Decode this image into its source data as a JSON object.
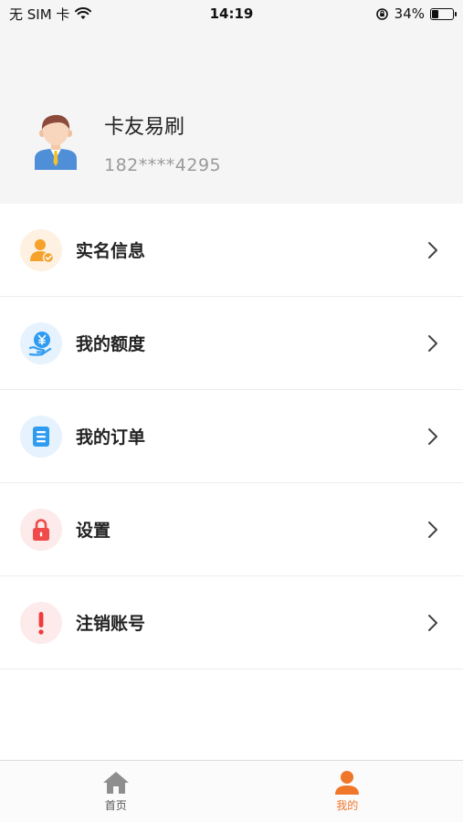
{
  "status_bar": {
    "carrier": "无 SIM 卡",
    "time": "14:19",
    "battery_percent_text": "34%",
    "battery_level": 0.34
  },
  "profile": {
    "name": "卡友易刷",
    "phone": "182****4295"
  },
  "menu": {
    "items": [
      {
        "label": "实名信息",
        "icon": "user-verified-icon",
        "color": "#f6a12b"
      },
      {
        "label": "我的额度",
        "icon": "yen-hand-icon",
        "color": "#2f9cf2"
      },
      {
        "label": "我的订单",
        "icon": "order-list-icon",
        "color": "#2f9cf2"
      },
      {
        "label": "设置",
        "icon": "lock-icon",
        "color": "#ef4b4b"
      },
      {
        "label": "注销账号",
        "icon": "exclamation-icon",
        "color": "#ef3b3b"
      }
    ]
  },
  "tabbar": {
    "home_label": "首页",
    "mine_label": "我的",
    "active_color": "#f0762a",
    "inactive_color": "#8e8e8e"
  }
}
